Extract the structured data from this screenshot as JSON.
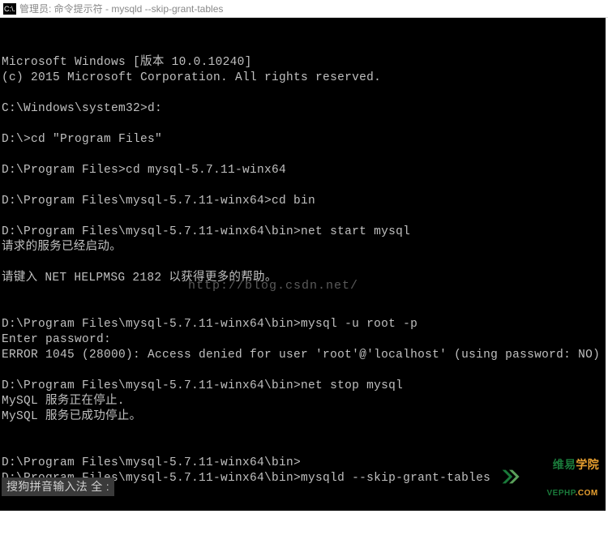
{
  "titlebar": {
    "icon_label": "C:\\.",
    "text": "管理员: 命令提示符 - mysqld  --skip-grant-tables"
  },
  "terminal": {
    "lines": [
      "Microsoft Windows [版本 10.0.10240]",
      "(c) 2015 Microsoft Corporation. All rights reserved.",
      "",
      "C:\\Windows\\system32>d:",
      "",
      "D:\\>cd \"Program Files\"",
      "",
      "D:\\Program Files>cd mysql-5.7.11-winx64",
      "",
      "D:\\Program Files\\mysql-5.7.11-winx64>cd bin",
      "",
      "D:\\Program Files\\mysql-5.7.11-winx64\\bin>net start mysql",
      "请求的服务已经启动。",
      "",
      "请键入 NET HELPMSG 2182 以获得更多的帮助。",
      "",
      "",
      "D:\\Program Files\\mysql-5.7.11-winx64\\bin>mysql -u root -p",
      "Enter password:",
      "ERROR 1045 (28000): Access denied for user 'root'@'localhost' (using password: NO)",
      "",
      "D:\\Program Files\\mysql-5.7.11-winx64\\bin>net stop mysql",
      "MySQL 服务正在停止.",
      "MySQL 服务已成功停止。",
      "",
      "",
      "D:\\Program Files\\mysql-5.7.11-winx64\\bin>",
      "D:\\Program Files\\mysql-5.7.11-winx64\\bin>mysqld --skip-grant-tables"
    ]
  },
  "watermark_url": "http://blog.csdn.net/",
  "ime": {
    "text": "搜狗拼音输入法 全 :"
  },
  "logo": {
    "cn_part1": "维易",
    "cn_part2": "学院",
    "url_part1": "VEPHP",
    "url_part2": ".COM"
  }
}
